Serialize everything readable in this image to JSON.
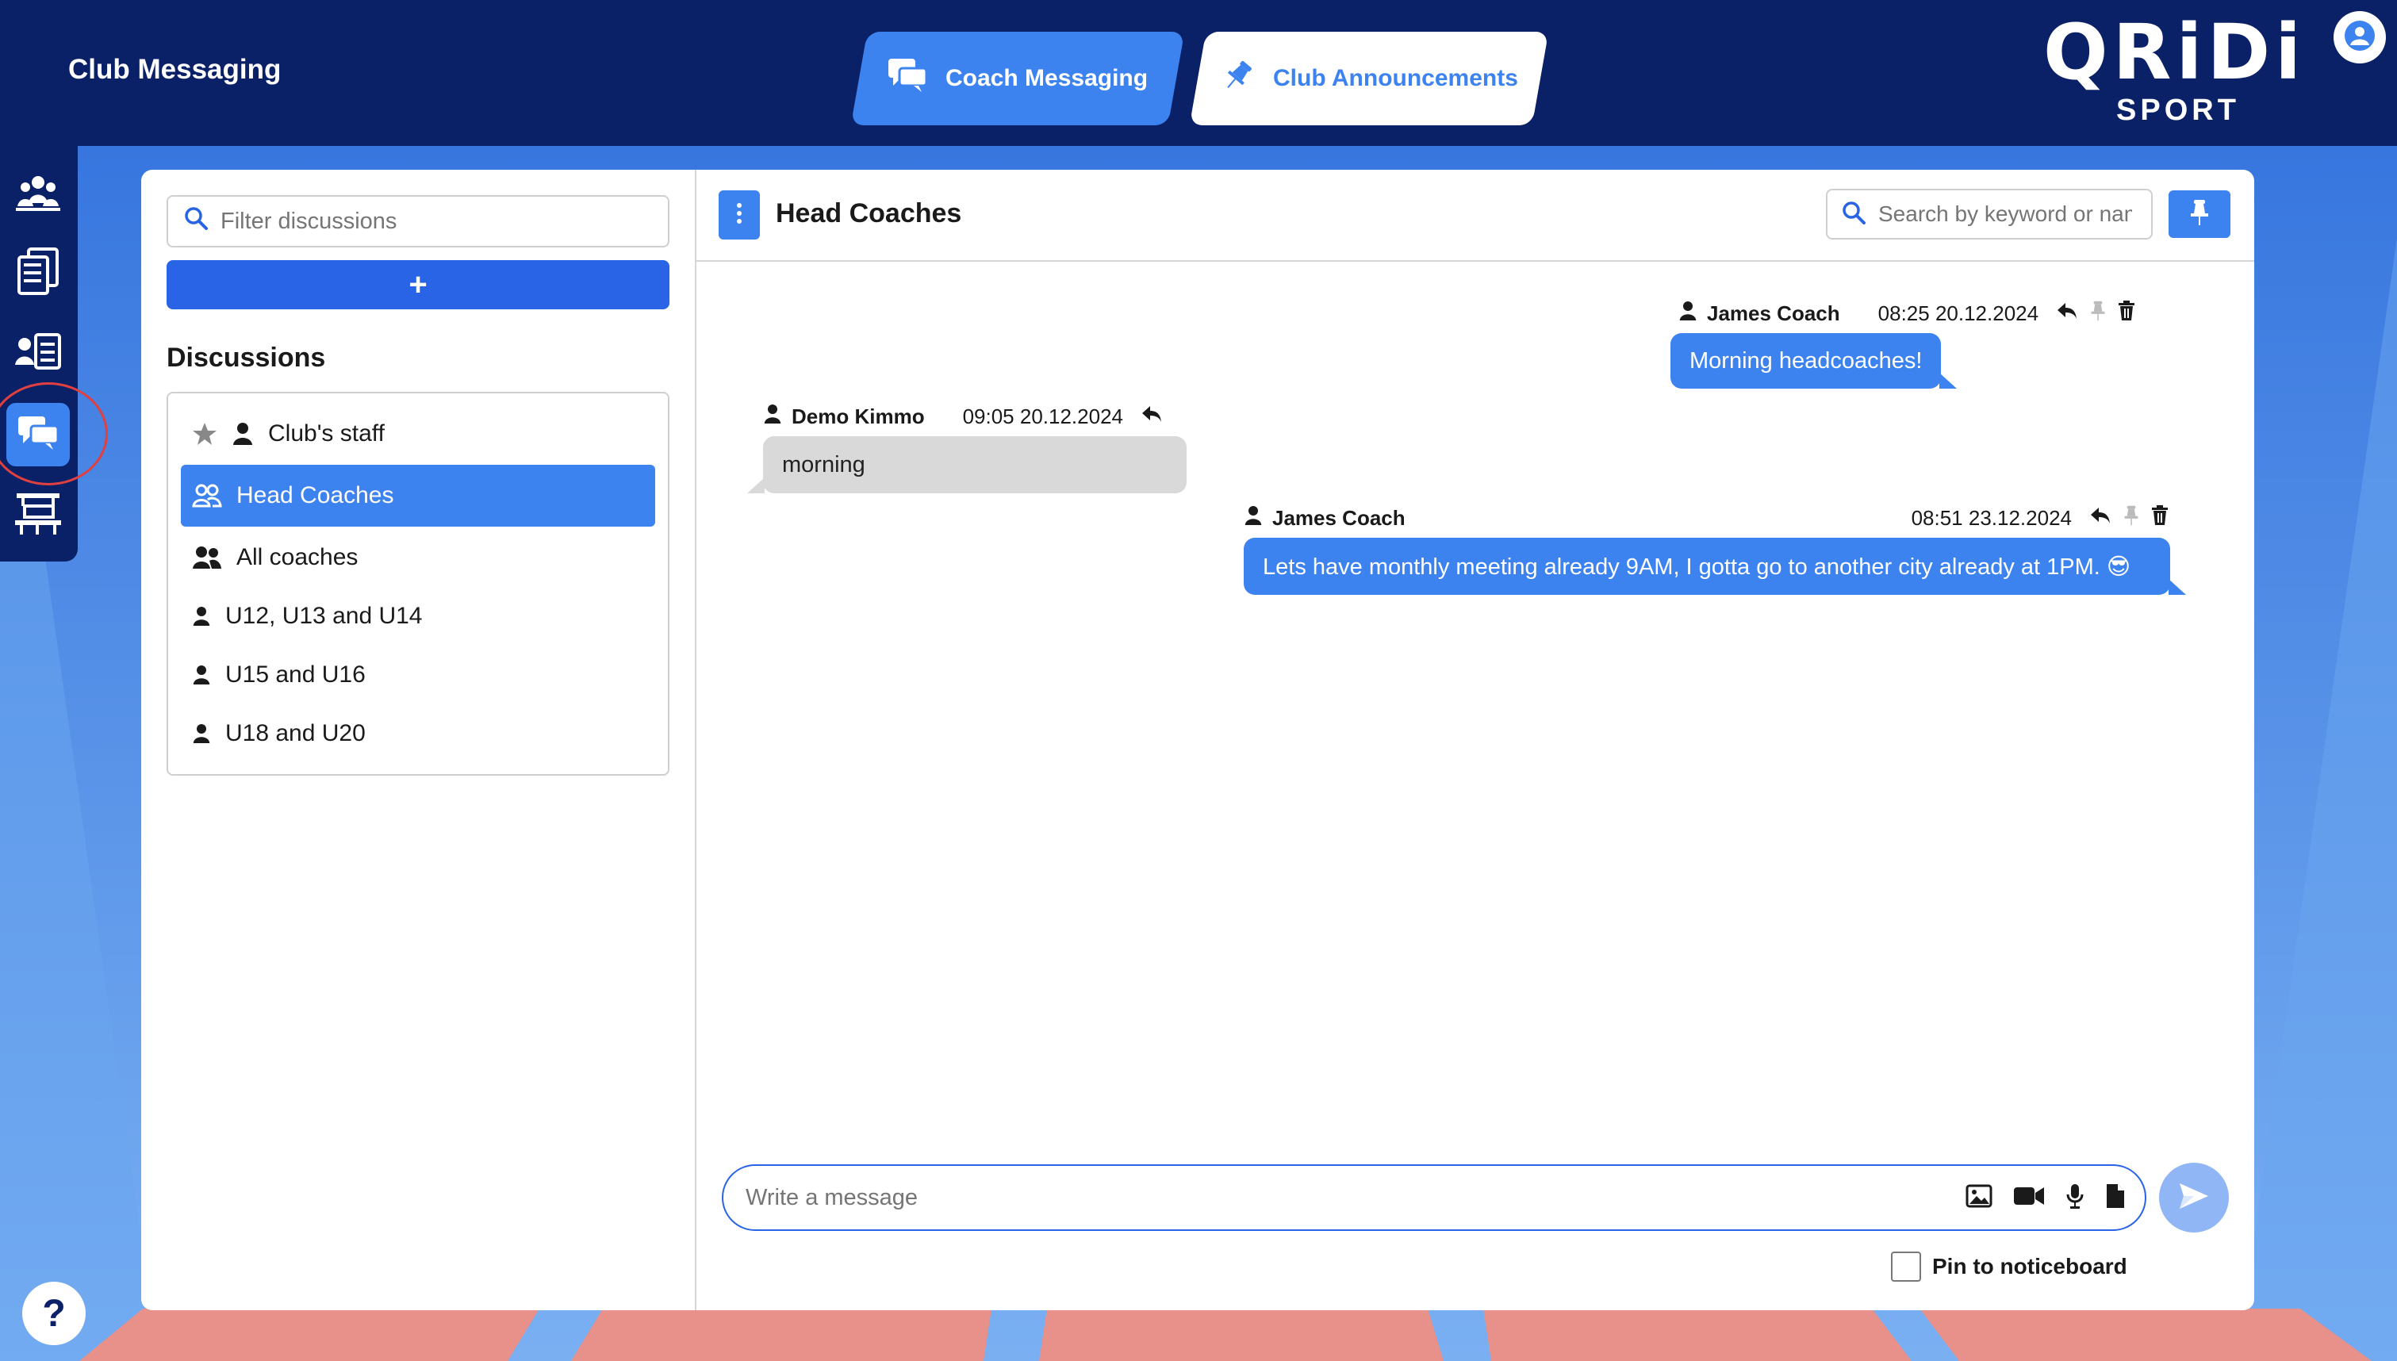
{
  "app": {
    "title": "Club Messaging"
  },
  "tabs": [
    {
      "label": "Coach Messaging",
      "icon": "chat-bubbles-icon",
      "active": true
    },
    {
      "label": "Club Announcements",
      "icon": "pushpin-icon",
      "active": false
    }
  ],
  "logo": {
    "top": "QRiDi",
    "bottom": "SPORT"
  },
  "sidebar": {
    "items": [
      {
        "icon": "team-people-icon",
        "active": false
      },
      {
        "icon": "documents-icon",
        "active": false
      },
      {
        "icon": "person-list-icon",
        "active": false
      },
      {
        "icon": "chat-bubbles-icon",
        "active": true
      },
      {
        "icon": "board-table-icon",
        "active": false
      }
    ]
  },
  "left_panel": {
    "filter_placeholder": "Filter discussions",
    "add_label": "+",
    "discussions_heading": "Discussions",
    "discussions": [
      {
        "label": "Club's staff",
        "icon": "person-icon",
        "starred": true,
        "selected": false
      },
      {
        "label": "Head Coaches",
        "icon": "people-icon",
        "selected": true
      },
      {
        "label": "All coaches",
        "icon": "people-icon",
        "selected": false
      },
      {
        "label": "U12, U13 and U14",
        "icon": "person-icon",
        "selected": false
      },
      {
        "label": "U15 and U16",
        "icon": "person-icon",
        "selected": false
      },
      {
        "label": "U18 and U20",
        "icon": "person-icon",
        "selected": false
      }
    ]
  },
  "chat": {
    "title": "Head Coaches",
    "search_placeholder": "Search by keyword or name",
    "messages": [
      {
        "author": "James Coach",
        "time": "08:25 20.12.2024",
        "text": "Morning headcoaches!",
        "own": true
      },
      {
        "author": "Demo Kimmo",
        "time": "09:05 20.12.2024",
        "text": "morning",
        "own": false
      },
      {
        "author": "James Coach",
        "time": "08:51 23.12.2024",
        "text": "Lets have monthly meeting already 9AM, I gotta go to another city already at 1PM. 😎",
        "own": true
      }
    ],
    "compose_placeholder": "Write a message",
    "pin_label": "Pin to noticeboard"
  },
  "help": {
    "label": "?"
  },
  "colors": {
    "navy": "#0b2167",
    "accent": "#3d83f0",
    "button": "#2a64e6"
  }
}
